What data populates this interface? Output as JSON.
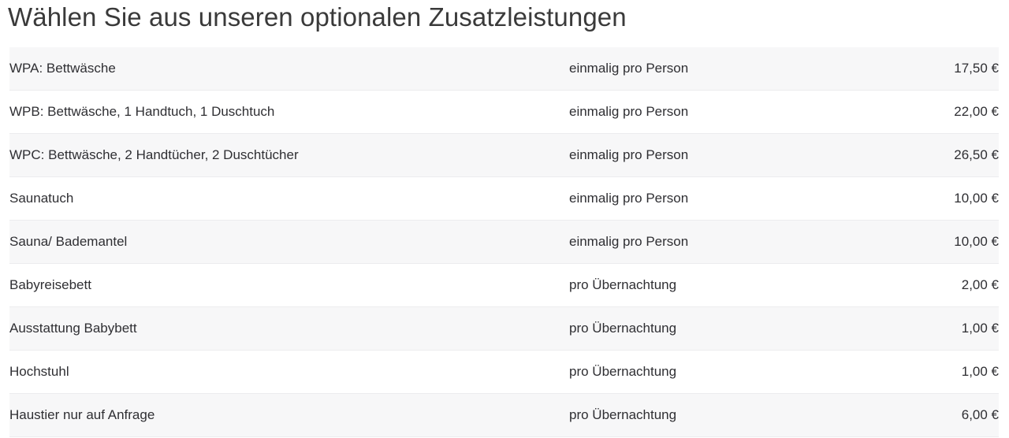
{
  "heading": "Wählen Sie aus unseren optionalen Zusatzleistungen",
  "colors": {
    "heading_text": "#3a3a3a",
    "body_text": "#2f2f33",
    "row_stripe": "#f7f7f8",
    "row_plain": "#ffffff",
    "row_border": "#ececee",
    "page_background": "#ffffff"
  },
  "currency_symbol": "€",
  "table": {
    "rows": [
      {
        "name": "WPA: Bettwäsche",
        "unit": "einmalig pro Person",
        "price": "17,50 €"
      },
      {
        "name": "WPB: Bettwäsche, 1 Handtuch, 1 Duschtuch",
        "unit": "einmalig pro Person",
        "price": "22,00 €"
      },
      {
        "name": "WPC: Bettwäsche, 2 Handtücher, 2 Duschtücher",
        "unit": "einmalig pro Person",
        "price": "26,50 €"
      },
      {
        "name": "Saunatuch",
        "unit": "einmalig pro Person",
        "price": "10,00 €"
      },
      {
        "name": "Sauna/ Bademantel",
        "unit": "einmalig pro Person",
        "price": "10,00 €"
      },
      {
        "name": "Babyreisebett",
        "unit": "pro Übernachtung",
        "price": "2,00 €"
      },
      {
        "name": "Ausstattung Babybett",
        "unit": "pro Übernachtung",
        "price": "1,00 €"
      },
      {
        "name": "Hochstuhl",
        "unit": "pro Übernachtung",
        "price": "1,00 €"
      },
      {
        "name": "Haustier nur auf Anfrage",
        "unit": "pro Übernachtung",
        "price": "6,00 €"
      }
    ]
  }
}
